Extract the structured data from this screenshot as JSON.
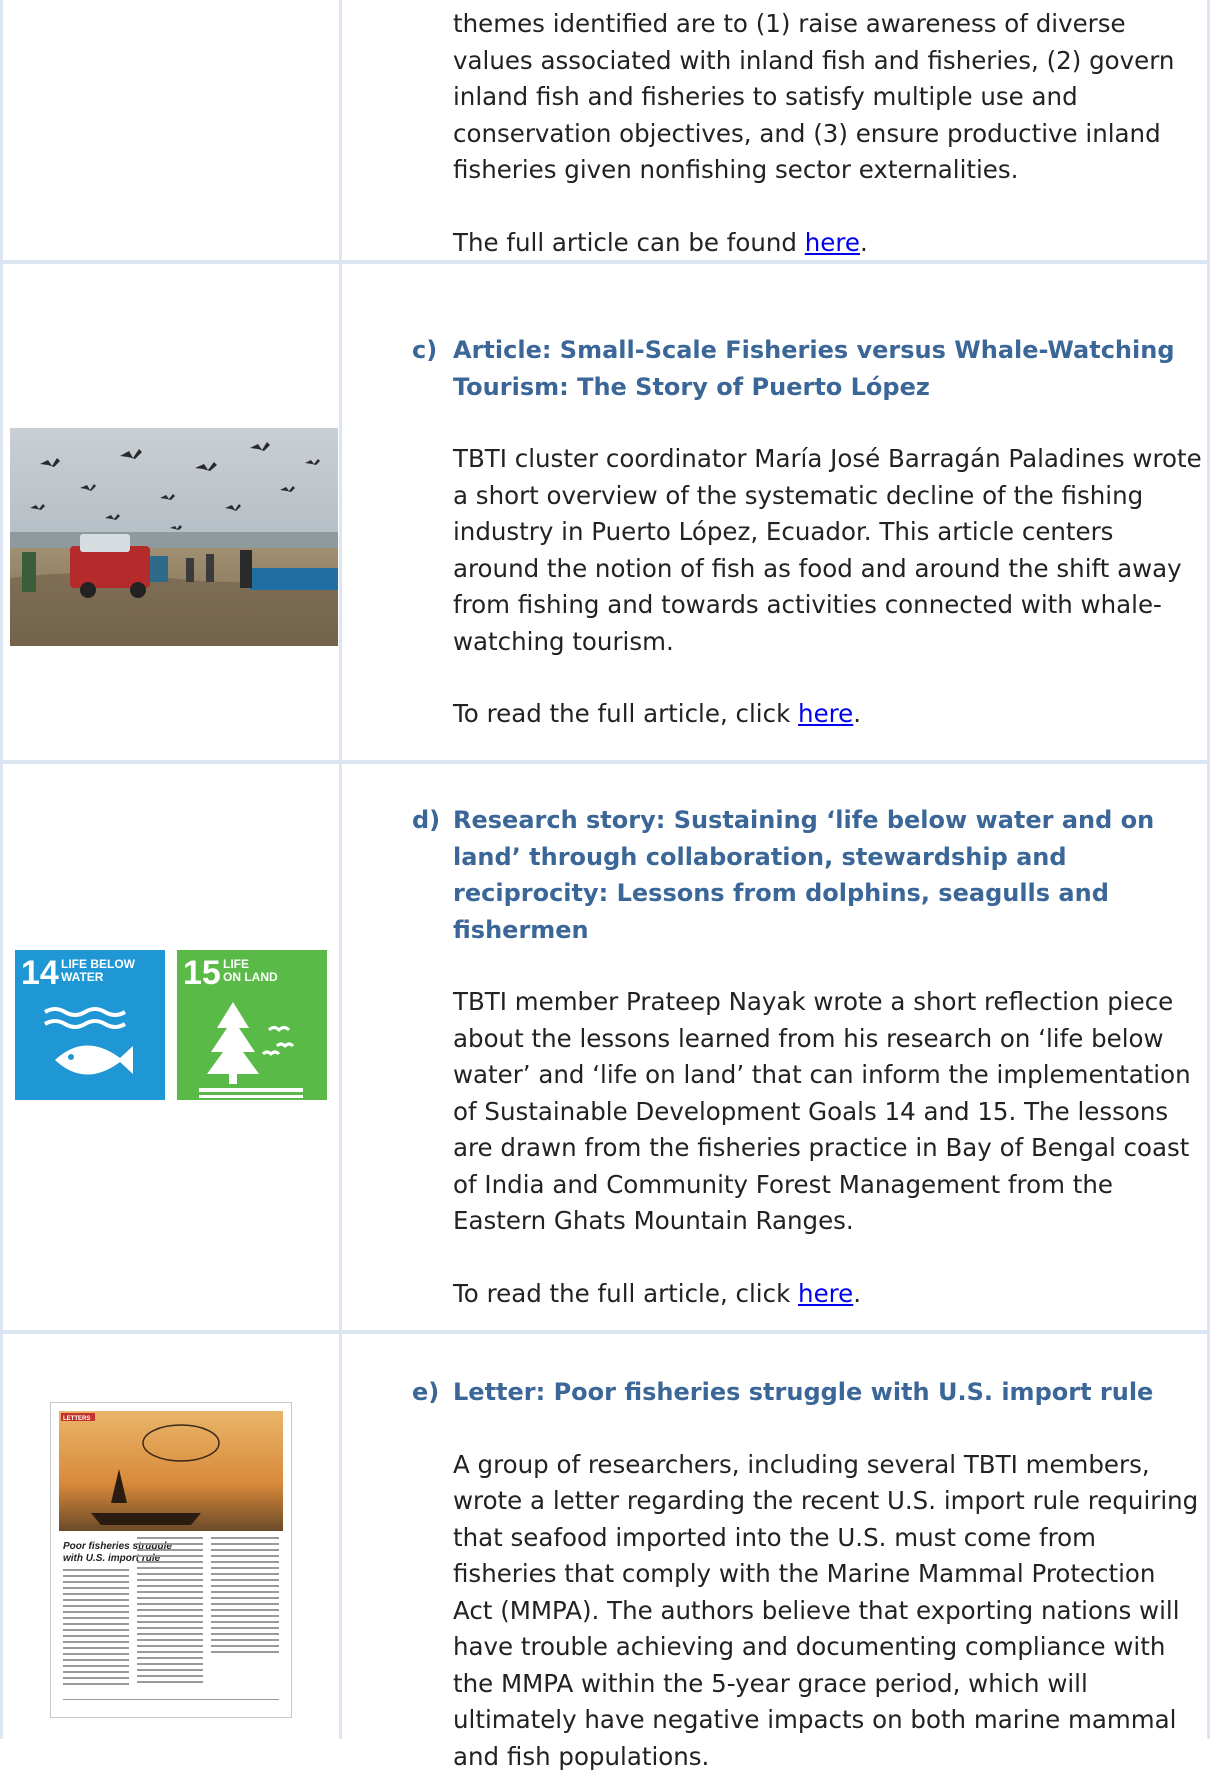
{
  "sections": {
    "b": {
      "continuation": "themes identified are to (1) raise awareness of diverse values associated with inland fish and fisheries, (2) govern inland fish and fisheries to satisfy multiple use and conservation objectives, and (3) ensure productive inland fisheries given nonfishing sector externalities.",
      "link_prefix": "The full article can be found ",
      "link_text": "here",
      "link_suffix": "."
    },
    "c": {
      "marker": "c)",
      "title": "Article: Small-Scale Fisheries versus Whale-Watching Tourism: The Story of Puerto López",
      "body": "TBTI cluster coordinator María José Barragán Paladines wrote a short overview of the systematic decline of the fishing industry in Puerto López, Ecuador. This article centers around the notion of fish as food and around the shift away from fishing and towards activities connected with whale-watching tourism.",
      "link_prefix": "To read the full article, click ",
      "link_text": "here",
      "link_suffix": "."
    },
    "d": {
      "marker": "d)",
      "title": "Research story: Sustaining ‘life below water and on land’ through collaboration, stewardship and reciprocity: Lessons from dolphins, seagulls and fishermen",
      "body": "TBTI member Prateep Nayak wrote a short reflection piece about the lessons learned from his research on ‘life below water’ and ‘life on land’ that can inform the implementation of Sustainable Development Goals 14 and 15. The lessons are drawn from the fisheries practice in Bay of Bengal coast of India and Community Forest Management from the Eastern Ghats Mountain Ranges.",
      "link_prefix": "To read the full article, click ",
      "link_text": "here",
      "link_suffix": ".",
      "sdg_tiles": [
        {
          "number": "14",
          "line1": "LIFE BELOW",
          "line2": "WATER",
          "color": "#1f97d4"
        },
        {
          "number": "15",
          "line1": "LIFE",
          "line2": "ON LAND",
          "color": "#59ba47"
        }
      ]
    },
    "e": {
      "marker": "e)",
      "title": "Letter: Poor fisheries struggle with U.S. import rule",
      "body": "A group of researchers, including several TBTI members, wrote a letter regarding the recent U.S. import rule requiring that seafood imported into the U.S. must come from fisheries that comply with the Marine Mammal Protection Act (MMPA). The authors believe that exporting nations will have trouble achieving and documenting compliance with the MMPA within the 5-year grace period, which will ultimately have negative impacts on both marine mammal and fish populations.",
      "thumb_tag": "LETTERS",
      "thumb_headline_1": "Poor fisheries struggle",
      "thumb_headline_2": "with U.S. import rule"
    }
  },
  "colors": {
    "heading": "#3b6798",
    "link": "#0000ee",
    "table_border": "#dce6f2"
  }
}
